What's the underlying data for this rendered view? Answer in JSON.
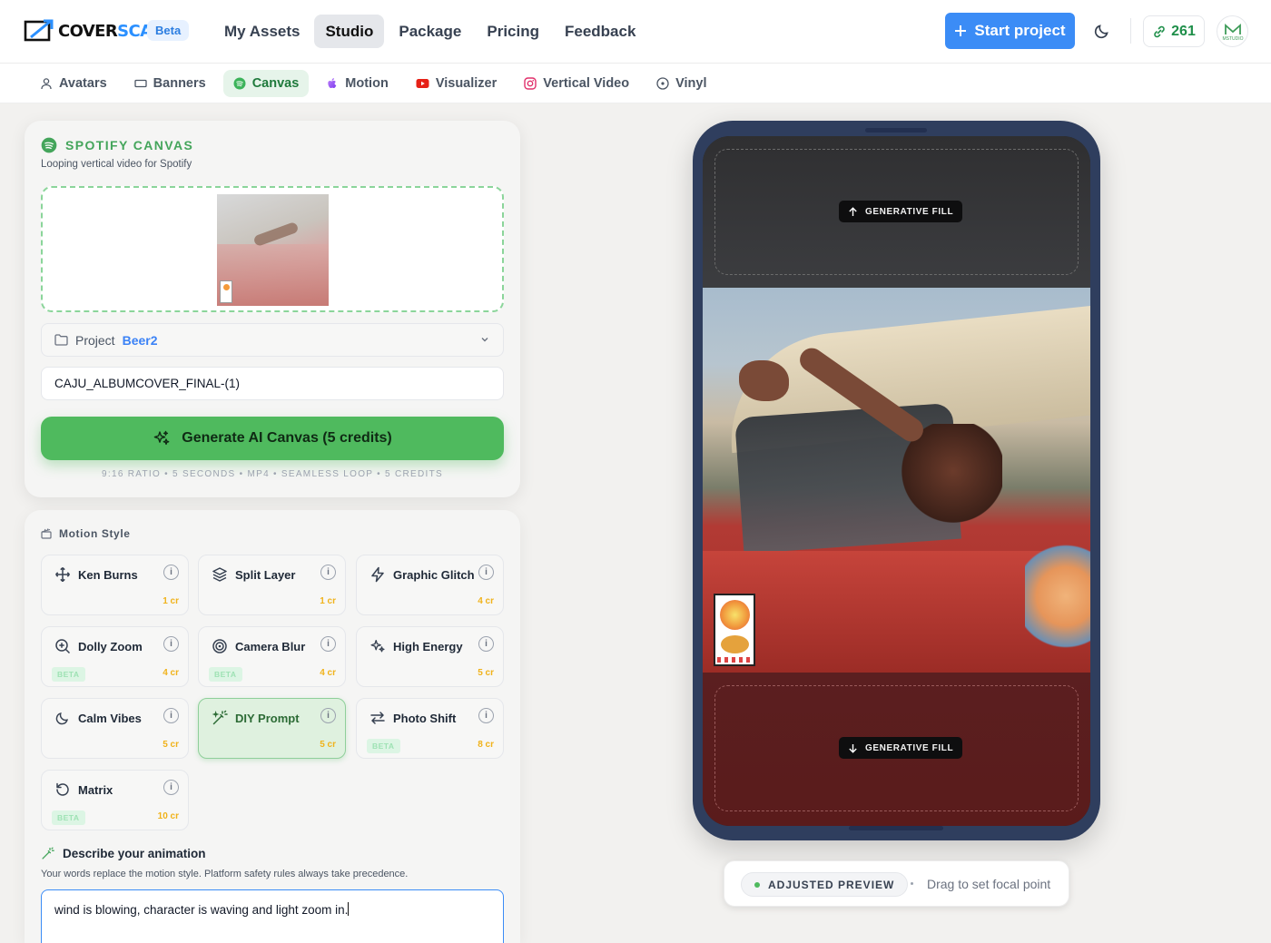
{
  "brand": {
    "name_a": "COVER",
    "name_b": "SCALE",
    "badge": "Beta",
    "accent": "#2b90ff"
  },
  "mainnav": [
    {
      "label": "My Assets",
      "active": false
    },
    {
      "label": "Studio",
      "active": true
    },
    {
      "label": "Package",
      "active": false
    },
    {
      "label": "Pricing",
      "active": false
    },
    {
      "label": "Feedback",
      "active": false
    }
  ],
  "header": {
    "start_label": "Start project",
    "credits": "261",
    "theme_icon": "moon-icon",
    "avatar_text": "MSTUDIO"
  },
  "subnav": [
    {
      "label": "Avatars",
      "icon": "user-icon"
    },
    {
      "label": "Banners",
      "icon": "banner-icon"
    },
    {
      "label": "Canvas",
      "icon": "spotify-icon",
      "active": true
    },
    {
      "label": "Motion",
      "icon": "apple-icon"
    },
    {
      "label": "Visualizer",
      "icon": "youtube-icon"
    },
    {
      "label": "Vertical Video",
      "icon": "instagram-icon"
    },
    {
      "label": "Vinyl",
      "icon": "vinyl-icon"
    }
  ],
  "canvas_card": {
    "title": "SPOTIFY CANVAS",
    "subtitle": "Looping vertical video for Spotify",
    "project_label": "Project",
    "project_value": "Beer2",
    "filename": "CAJU_ALBUMCOVER_FINAL-(1)",
    "generate_label": "Generate AI Canvas (5 credits)",
    "meta": "9:16 RATIO • 5 SECONDS • MP4 • SEAMLESS LOOP • 5 CREDITS",
    "accent": "#4fba5e"
  },
  "motion": {
    "title": "Motion Style",
    "styles": [
      {
        "name": "Ken Burns",
        "cost": "1 cr",
        "beta": ""
      },
      {
        "name": "Split Layer",
        "cost": "1 cr",
        "beta": ""
      },
      {
        "name": "Graphic Glitch",
        "cost": "4 cr",
        "beta": ""
      },
      {
        "name": "Dolly Zoom",
        "cost": "4 cr",
        "beta": "BETA"
      },
      {
        "name": "Camera Blur",
        "cost": "4 cr",
        "beta": "BETA"
      },
      {
        "name": "High Energy",
        "cost": "5 cr",
        "beta": ""
      },
      {
        "name": "Calm Vibes",
        "cost": "5 cr",
        "beta": ""
      },
      {
        "name": "DIY Prompt",
        "cost": "5 cr",
        "beta": "",
        "active": true
      },
      {
        "name": "Photo Shift",
        "cost": "8 cr",
        "beta": "BETA"
      },
      {
        "name": "Matrix",
        "cost": "10 cr",
        "beta": "BETA"
      }
    ],
    "info_glyph": "i",
    "describe_title": "Describe your animation",
    "describe_sub": "Your words replace the motion style. Platform safety rules always take precedence.",
    "prompt_value": "wind is blowing, character is waving and light zoom in."
  },
  "preview": {
    "fill_label": "GENERATIVE FILL",
    "mode_label": "ADJUSTED PREVIEW",
    "hint": "Drag to set focal point"
  }
}
